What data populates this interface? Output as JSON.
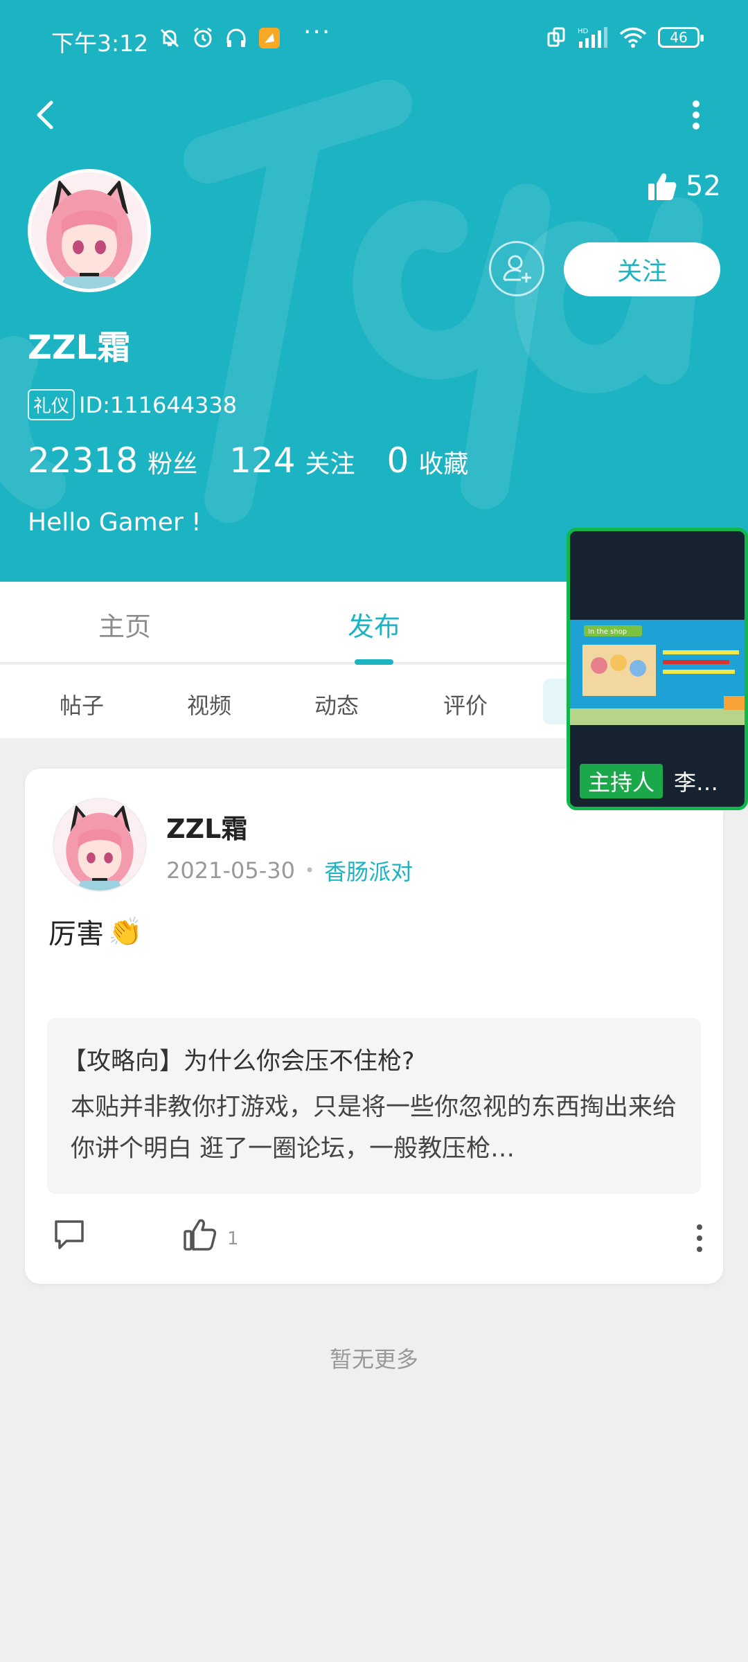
{
  "status_bar": {
    "time": "下午3:12",
    "more": "···",
    "battery": "46",
    "icons": [
      "mute-icon",
      "alarm-icon",
      "headset-icon",
      "app-notification-icon",
      "screen-rotate-icon",
      "signal-icon",
      "wifi-icon",
      "battery-icon"
    ]
  },
  "profile": {
    "likes": "52",
    "follow_label": "关注",
    "username": "ZZL霜",
    "badge": "礼仪",
    "id_text": "ID:111644338",
    "stats": [
      {
        "num": "22318",
        "label": "粉丝"
      },
      {
        "num": "124",
        "label": "关注"
      },
      {
        "num": "0",
        "label": "收藏"
      }
    ],
    "bio": "Hello Gamer !"
  },
  "tabs": [
    "主页",
    "发布"
  ],
  "subtabs": [
    "帖子",
    "视频",
    "动态",
    "评价"
  ],
  "post": {
    "username": "ZZL霜",
    "date": "2021-05-30",
    "tag": "香肠派对",
    "text": "厉害",
    "emoji": "👏",
    "quote_title": "【攻略向】为什么你会压不住枪?",
    "quote_body": "本贴并非教你打游戏，只是将一些你忽视的东西掏出来给你讲个明白  逛了一圈论坛，一般教压枪…",
    "like_count": "1"
  },
  "footer_text": "暂无更多",
  "pip": {
    "host_label": "主持人",
    "name": "李…",
    "slide_title": "In the shop"
  },
  "colors": {
    "accent": "#1cb3c2",
    "pip_border": "#11b64c"
  }
}
